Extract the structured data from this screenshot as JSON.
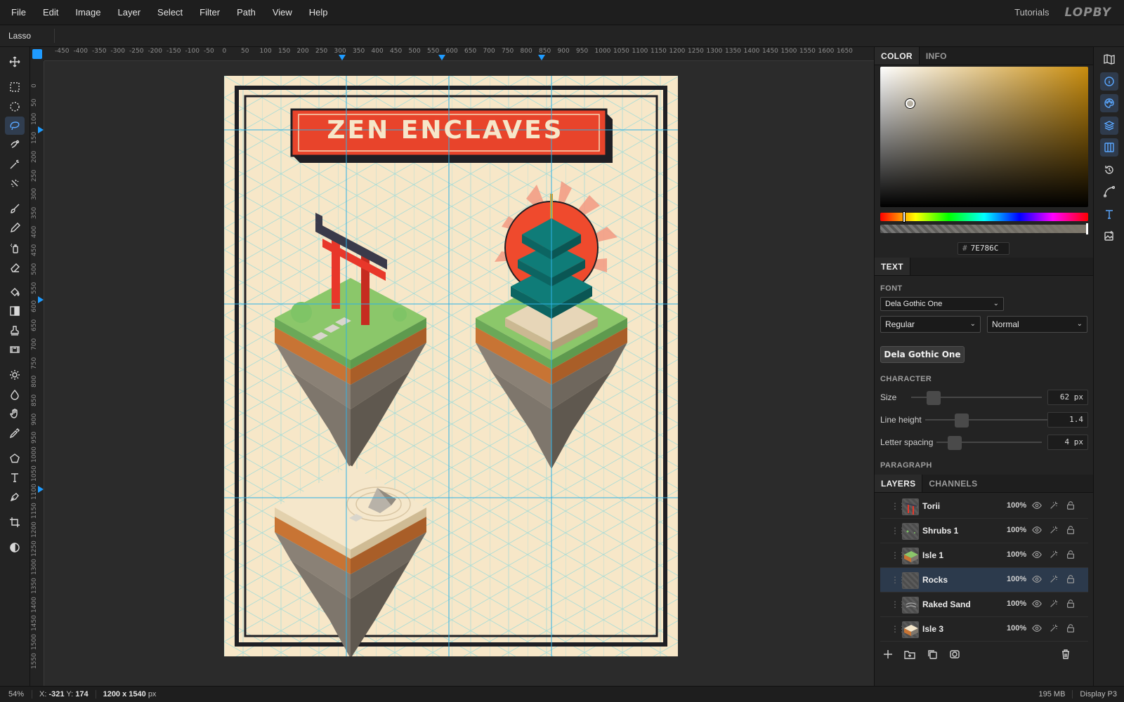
{
  "menu": {
    "items": [
      "File",
      "Edit",
      "Image",
      "Layer",
      "Select",
      "Filter",
      "Path",
      "View",
      "Help"
    ],
    "tutorials": "Tutorials",
    "logo": "LOPBY"
  },
  "options": {
    "tool_name": "Lasso"
  },
  "toolbar": {
    "tools": [
      "move-tool",
      "rect-select-tool",
      "ellipse-select-tool",
      "lasso-tool",
      "quick-select-tool",
      "magic-wand-tool",
      "object-select-tool",
      "brush-tool",
      "pencil-tool",
      "spray-tool",
      "eraser-tool",
      "fill-tool",
      "gradient-tool",
      "stamp-tool",
      "filmstrip-tool",
      "dodge-tool",
      "blur-tool",
      "hand-tool",
      "eyedropper-tool",
      "shape-tool",
      "text-tool",
      "pen-tool",
      "crop-tool",
      "contrast-tool"
    ],
    "active": "lasso-tool"
  },
  "rulers": {
    "h_ticks": [
      "-450",
      "-400",
      "-350",
      "-300",
      "-250",
      "-200",
      "-150",
      "-100",
      "-50",
      "0",
      "50",
      "100",
      "150",
      "200",
      "250",
      "300",
      "350",
      "400",
      "450",
      "500",
      "550",
      "600",
      "650",
      "700",
      "750",
      "800",
      "850",
      "900",
      "950",
      "1000",
      "1050",
      "1100",
      "1150",
      "1200",
      "1250",
      "1300",
      "1350",
      "1400",
      "1450",
      "1500",
      "1550",
      "1600",
      "1650"
    ],
    "v_ticks": [
      "0",
      "50",
      "100",
      "150",
      "200",
      "250",
      "300",
      "350",
      "400",
      "450",
      "500",
      "550",
      "600",
      "650",
      "700",
      "750",
      "800",
      "850",
      "900",
      "950",
      "1000",
      "1050",
      "1100",
      "1150",
      "1200",
      "1250",
      "1300",
      "1350",
      "1400",
      "1450",
      "1500",
      "1550"
    ]
  },
  "document": {
    "title_text": "ZEN ENCLAVES",
    "colors": {
      "paper": "#f7e7c8",
      "grid": "#a9dcd6",
      "guide": "#2db2e6",
      "border": "#1f1f24",
      "banner": "#e8442b",
      "banner_shadow": "#b32e1a",
      "grass": "#8bc76a",
      "dirt": "#c87434",
      "rock": "#7e766c",
      "teal": "#0f7c78",
      "sun": "#ef4a2d",
      "torii": "#e8372a",
      "torii_top": "#3a3a4a"
    }
  },
  "color_panel": {
    "tabs": [
      "COLOR",
      "INFO"
    ],
    "active_tab": "COLOR",
    "hex_value": "7E786C",
    "hex_prefix": "#",
    "field_hue": "#c98d0e"
  },
  "text_panel": {
    "tab": "TEXT",
    "font_label": "FONT",
    "font_family": "Dela Gothic One",
    "weight": "Regular",
    "style": "Normal",
    "preview": "Dela Gothic One",
    "character_label": "CHARACTER",
    "size_label": "Size",
    "size_value": "62 px",
    "line_height_label": "Line height",
    "line_height_value": "1.4",
    "letter_spacing_label": "Letter spacing",
    "letter_spacing_value": "4 px",
    "paragraph_label": "PARAGRAPH"
  },
  "layers_panel": {
    "tabs": [
      "LAYERS",
      "CHANNELS"
    ],
    "active_tab": "LAYERS",
    "layers": [
      {
        "name": "Torii",
        "opacity": "100%",
        "selected": false
      },
      {
        "name": "Shrubs 1",
        "opacity": "100%",
        "selected": false
      },
      {
        "name": "Isle 1",
        "opacity": "100%",
        "selected": false
      },
      {
        "name": "Rocks",
        "opacity": "100%",
        "selected": true
      },
      {
        "name": "Raked Sand",
        "opacity": "100%",
        "selected": false
      },
      {
        "name": "Isle 3",
        "opacity": "100%",
        "selected": false
      }
    ]
  },
  "rail": {
    "buttons": [
      "map-icon",
      "info-icon",
      "palette-icon",
      "layers-icon",
      "columns-icon",
      "history-icon",
      "curve-icon",
      "text-icon",
      "image-edit-icon"
    ]
  },
  "status": {
    "zoom": "54%",
    "x_label": "X:",
    "x_value": "-321",
    "y_label": "Y:",
    "y_value": "174",
    "dims_value": "1200 x 1540",
    "dims_unit": "px",
    "memory": "195 MB",
    "profile": "Display P3"
  }
}
